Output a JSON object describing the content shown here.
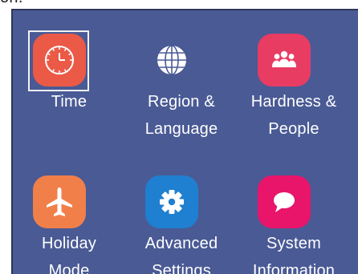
{
  "caption": "on.",
  "tiles": [
    {
      "line1": "Time",
      "line2": "",
      "icon": "clock-icon",
      "color": "#ea5a47",
      "selected": true
    },
    {
      "line1": "Region &",
      "line2": "Language",
      "icon": "globe-icon",
      "color": "#ffffff",
      "selected": false
    },
    {
      "line1": "Hardness &",
      "line2": "People",
      "icon": "people-icon",
      "color": "#e83c63",
      "selected": false
    },
    {
      "line1": "Holiday",
      "line2": "Mode",
      "icon": "airplane-icon",
      "color": "#f07f4a",
      "selected": false
    },
    {
      "line1": "Advanced",
      "line2": "Settings",
      "icon": "gear-icon",
      "color": "#1f7fd1",
      "selected": false
    },
    {
      "line1": "System",
      "line2": "Information",
      "icon": "speech-bubble-icon",
      "color": "#e8156b",
      "selected": false
    }
  ]
}
